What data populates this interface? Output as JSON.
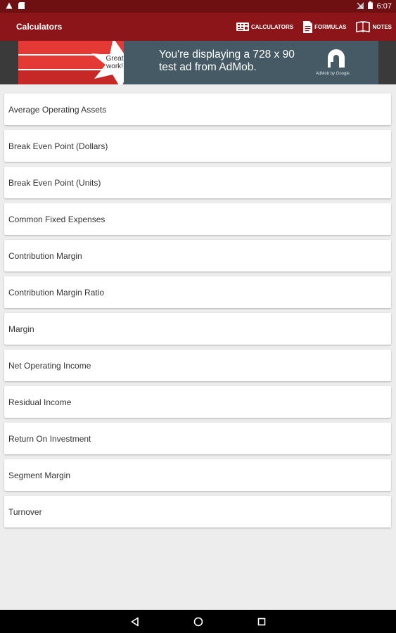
{
  "status_bar": {
    "time": "6:07",
    "icons": [
      "warning-icon",
      "sd-card-icon",
      "no-sim-icon",
      "battery-icon"
    ]
  },
  "app_bar": {
    "title": "Calculators",
    "actions": [
      {
        "label": "CALCULATORS",
        "icon": "calculator-icon"
      },
      {
        "label": "FORMULAS",
        "icon": "document-icon"
      },
      {
        "label": "NOTES",
        "icon": "book-icon"
      }
    ]
  },
  "ad": {
    "star_text": "Great work!",
    "text": "You're displaying a 728 x 90 test ad from AdMob.",
    "logo_caption": "AdMob by Google",
    "colors": {
      "background": "#455a64",
      "red": "#e53935",
      "dark_red": "#c62828"
    }
  },
  "list": {
    "items": [
      "Average Operating Assets",
      "Break Even Point (Dollars)",
      "Break Even Point (Units)",
      "Common Fixed Expenses",
      "Contribution Margin",
      "Contribution Margin Ratio",
      "Margin",
      "Net Operating Income",
      "Residual Income",
      "Return On Investment",
      "Segment Margin",
      "Turnover"
    ]
  },
  "nav_bar": {
    "buttons": [
      "back-icon",
      "home-icon",
      "recents-icon"
    ]
  },
  "colors": {
    "status_bar": "#6e0f12",
    "app_bar": "#8b1518",
    "background": "#ededed"
  }
}
